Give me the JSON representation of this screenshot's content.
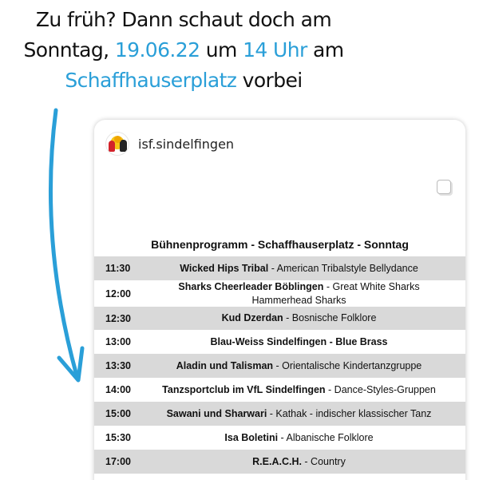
{
  "headline": {
    "line1": "Zu früh? Dann schaut doch am",
    "line2_prefix": "Sonntag, ",
    "line2_date": "19.06.22",
    "line2_mid": " um ",
    "line2_time": "14 Uhr",
    "line2_suffix": " am",
    "line3_place": "Schaffhauserplatz",
    "line3_suffix": " vorbei"
  },
  "colors": {
    "accent": "#2a9fd8",
    "row_shade": "#d9d9d9"
  },
  "post": {
    "account": "isf.sindelfingen",
    "avatar_icon": "club-logo-icon",
    "title": "Bühnenprogramm - Schaffhauserplatz - Sonntag",
    "schedule": [
      {
        "time": "11:30",
        "act": "Wicked Hips Tribal",
        "detail": " - American Tribalstyle Bellydance"
      },
      {
        "time": "12:00",
        "act": "Sharks Cheerleader Böblingen",
        "detail": " - Great White Sharks Hammerhead Sharks"
      },
      {
        "time": "12:30",
        "act": "Kud Dzerdan",
        "detail": " - Bosnische Folklore"
      },
      {
        "time": "13:00",
        "act": "Blau-Weiss Sindelfingen - Blue Brass",
        "detail": ""
      },
      {
        "time": "13:30",
        "act": "Aladin und Talisman",
        "detail": " - Orientalische Kindertanzgruppe"
      },
      {
        "time": "14:00",
        "act": "Tanzsportclub im VfL Sindelfingen",
        "detail": " - Dance-Styles-Gruppen"
      },
      {
        "time": "15:00",
        "act": "Sawani und Sharwari",
        "detail": " - Kathak - indischer klassischer Tanz"
      },
      {
        "time": "15:30",
        "act": "Isa Boletini",
        "detail": " - Albanische Folklore"
      },
      {
        "time": "17:00",
        "act": "R.E.A.C.H.",
        "detail": " - Country"
      }
    ]
  }
}
